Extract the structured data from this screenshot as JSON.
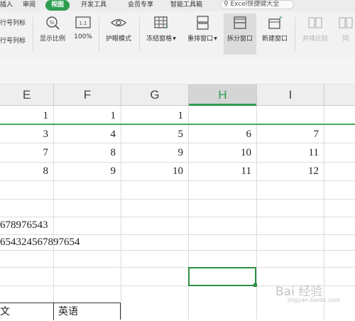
{
  "ribbon_tabs": [
    "插入",
    "审阅",
    "视图",
    "开发工具",
    "会员专享",
    "智能工具箱"
  ],
  "search": {
    "placeholder": "Excel快捷键大全"
  },
  "ribbon_left": {
    "row1": "行号列标",
    "row2": "行号列标"
  },
  "ribbon_buttons": {
    "display_ratio": "显示比例",
    "zoom": "100%",
    "eye_mode": "护眼模式",
    "freeze": "冻结窗格",
    "rearrange": "重排窗口",
    "split": "拆分窗口",
    "new_window": "新建窗口",
    "side_by_side": "并排比较",
    "more": "同"
  },
  "columns": [
    "E",
    "F",
    "G",
    "H",
    "I"
  ],
  "selected_column": "H",
  "rows": [
    {
      "E": "1",
      "F": "1",
      "G": "1",
      "H": "",
      "I": ""
    },
    {
      "E": "3",
      "F": "4",
      "G": "5",
      "H": "6",
      "I": "7"
    },
    {
      "E": "7",
      "F": "8",
      "G": "9",
      "H": "10",
      "I": "11"
    },
    {
      "E": "8",
      "F": "9",
      "G": "10",
      "H": "11",
      "I": "12"
    }
  ],
  "long_values": [
    "678976543",
    "654324567897654"
  ],
  "table_headers": [
    "文",
    "英语"
  ],
  "watermark": "Bai 经验",
  "watermark_url": "jingyan.baidu.com",
  "colors": {
    "accent": "#2f9d51",
    "selection": "#2f8f45"
  }
}
